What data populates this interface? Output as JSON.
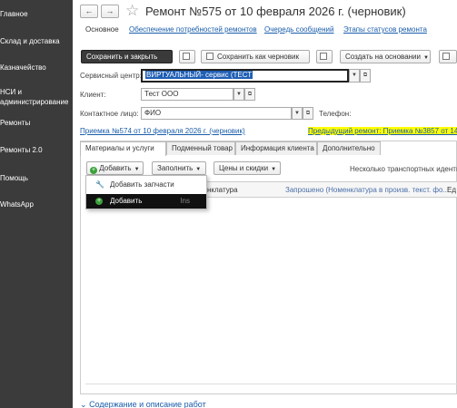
{
  "sidebar": {
    "items": [
      {
        "label": "Главное"
      },
      {
        "label": "Склад и доставка"
      },
      {
        "label": "Казначейство"
      },
      {
        "label": "НСИ и администрирование"
      },
      {
        "label": "Ремонты"
      },
      {
        "label": "Ремонты 2.0"
      },
      {
        "label": "Помощь"
      },
      {
        "label": "WhatsApp"
      }
    ]
  },
  "header": {
    "back": "←",
    "forward": "→",
    "star": "☆",
    "title": "Ремонт №575 от 10 февраля 2026 г. (черновик)"
  },
  "top_tabs": [
    {
      "label": "Основное"
    },
    {
      "label": "Обеспечение потребностей ремонтов"
    },
    {
      "label": "Очередь сообщений"
    },
    {
      "label": "Этапы статусов ремонта"
    }
  ],
  "toolbar": {
    "save_close": "Сохранить и закрыть",
    "save_draft": "Сохранить как черновик",
    "create_based": "Создать на основании"
  },
  "form": {
    "service_center_label": "Сервисный центр:",
    "service_center_value": "ВИРТУАЛЬНЫЙ- сервис (ТЕСТ",
    "client_label": "Клиент:",
    "client_value": "Тест ООО",
    "contact_label": "Контактное лицо:",
    "contact_value": "ФИО",
    "phone_label": "Телефон:"
  },
  "links": {
    "reception": "Приемка №574 от 10 февраля 2026 г. (черновик)",
    "previous": "Предыдущий ремонт: Приемка №3857 от 14"
  },
  "panel_tabs": [
    {
      "label": "Материалы и услуги"
    },
    {
      "label": "Подменный товар"
    },
    {
      "label": "Информация клиента"
    },
    {
      "label": "Дополнительно"
    }
  ],
  "panel_toolbar": {
    "add": "Добавить",
    "fill": "Заполнить",
    "prices": "Цены и скидки",
    "info": "Несколько транспортных иденти"
  },
  "grid": {
    "columns": [
      "нклатура",
      "Запрошено (Номенклатура в произв. текст. фо...",
      "Ед"
    ]
  },
  "popup": {
    "items": [
      {
        "label": "Добавить запчасти",
        "shortcut": ""
      },
      {
        "label": "Добавить",
        "shortcut": "Ins"
      }
    ]
  },
  "bottom": {
    "section": "Содержание и описание работ"
  }
}
